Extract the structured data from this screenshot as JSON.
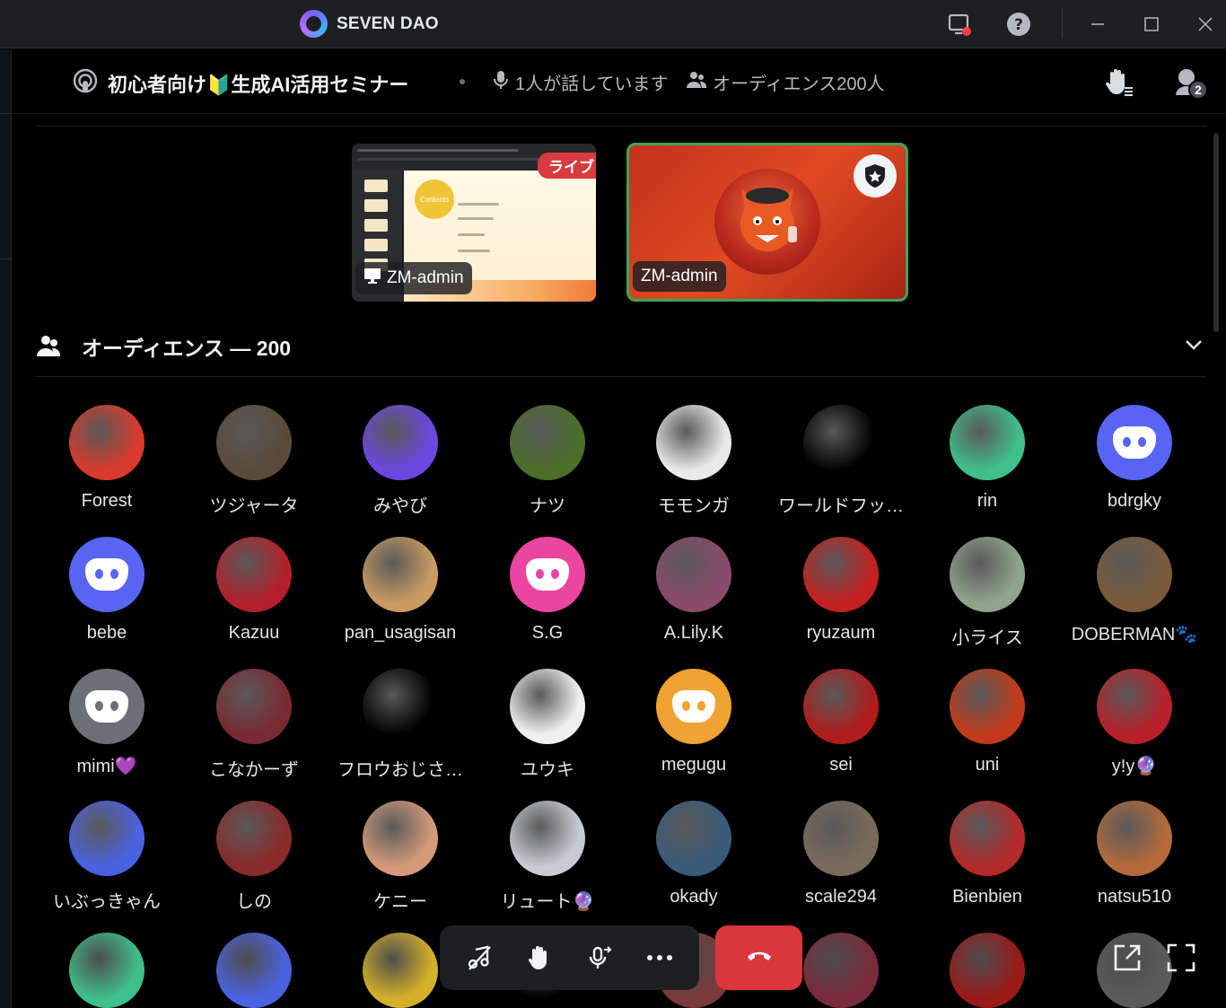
{
  "app": {
    "name": "SEVEN DAO"
  },
  "titlebar": {
    "icons": [
      "screen-record-icon",
      "help-icon",
      "minimize-icon",
      "maximize-icon",
      "close-icon"
    ]
  },
  "stage": {
    "title": "初心者向け🔰生成AI活用セミナー",
    "speaking": "1人が話しています",
    "audience_meta": "オーディエンス200人",
    "request_badge": "2"
  },
  "tiles": [
    {
      "label": "ZM-admin",
      "live": "ライブ",
      "type": "screenshare",
      "slide_heading": "Contents"
    },
    {
      "label": "ZM-admin",
      "type": "camera"
    }
  ],
  "audience": {
    "title": "オーディエンス — 200",
    "members": [
      {
        "name": "Forest",
        "color": "#d93a2b",
        "discord": false
      },
      {
        "name": "ツジャータ",
        "color": "#5a4a3a",
        "discord": false
      },
      {
        "name": "みやび",
        "color": "#6a48e0",
        "discord": false
      },
      {
        "name": "ナツ",
        "color": "#4b6e2a",
        "discord": false
      },
      {
        "name": "モモンガ",
        "color": "#e9e9ea",
        "discord": false
      },
      {
        "name": "ワールドフッ…",
        "color": "#000000",
        "discord": false
      },
      {
        "name": "rin",
        "color": "#3fc08a",
        "discord": false
      },
      {
        "name": "bdrgky",
        "color": "#5865f2",
        "discord": true
      },
      {
        "name": "bebe",
        "color": "#5865f2",
        "discord": true
      },
      {
        "name": "Kazuu",
        "color": "#b4202a",
        "discord": false
      },
      {
        "name": "pan_usagisan",
        "color": "#c99a62",
        "discord": false
      },
      {
        "name": "S.G",
        "color": "#eb459f",
        "discord": true
      },
      {
        "name": "A.Lily.K",
        "color": "#8a4a6a",
        "discord": false
      },
      {
        "name": "ryuzaum",
        "color": "#c42020",
        "discord": false
      },
      {
        "name": "小ライス",
        "color": "#8fa48c",
        "discord": false
      },
      {
        "name": "DOBERMAN🐾",
        "color": "#7a5a3a",
        "discord": false
      },
      {
        "name": "mimi💜",
        "color": "#6d6f78",
        "discord": true
      },
      {
        "name": "こなかーず",
        "color": "#7a2a32",
        "discord": false
      },
      {
        "name": "フロウおじさ…",
        "color": "#000000",
        "discord": false
      },
      {
        "name": "ユウキ",
        "color": "#f0f0f0",
        "discord": false
      },
      {
        "name": "megugu",
        "color": "#f0a232",
        "discord": true
      },
      {
        "name": "sei",
        "color": "#b01c1c",
        "discord": false
      },
      {
        "name": "uni",
        "color": "#c23a1a",
        "discord": false
      },
      {
        "name": "y!y🔮",
        "color": "#b8202a",
        "discord": false
      },
      {
        "name": "いぶっきゃん",
        "color": "#4a62e0",
        "discord": false
      },
      {
        "name": "しの",
        "color": "#8a2a2a",
        "discord": false
      },
      {
        "name": "ケニー",
        "color": "#d49a7a",
        "discord": false
      },
      {
        "name": "リュート🔮",
        "color": "#c8ccd2",
        "discord": false
      },
      {
        "name": "okady",
        "color": "#3a5a7a",
        "discord": false
      },
      {
        "name": "scale294",
        "color": "#7a6a5a",
        "discord": false
      },
      {
        "name": "Bienbien",
        "color": "#b42a2a",
        "discord": false
      },
      {
        "name": "natsu510",
        "color": "#b46a3a",
        "discord": false
      }
    ],
    "partial_row_colors": [
      "#3fc08a",
      "#4a62e0",
      "#d4b02a",
      "#000000",
      "#7a3a3a",
      "#7a2a3a",
      "#9a1a1a",
      "#5a5a5a"
    ]
  },
  "controls": [
    "speaker-mute-icon",
    "raise-hand-icon",
    "request-speak-icon",
    "more-icon"
  ],
  "colors": {
    "accent": "#5865f2",
    "danger": "#da373c",
    "speaking": "#3ba55d"
  }
}
